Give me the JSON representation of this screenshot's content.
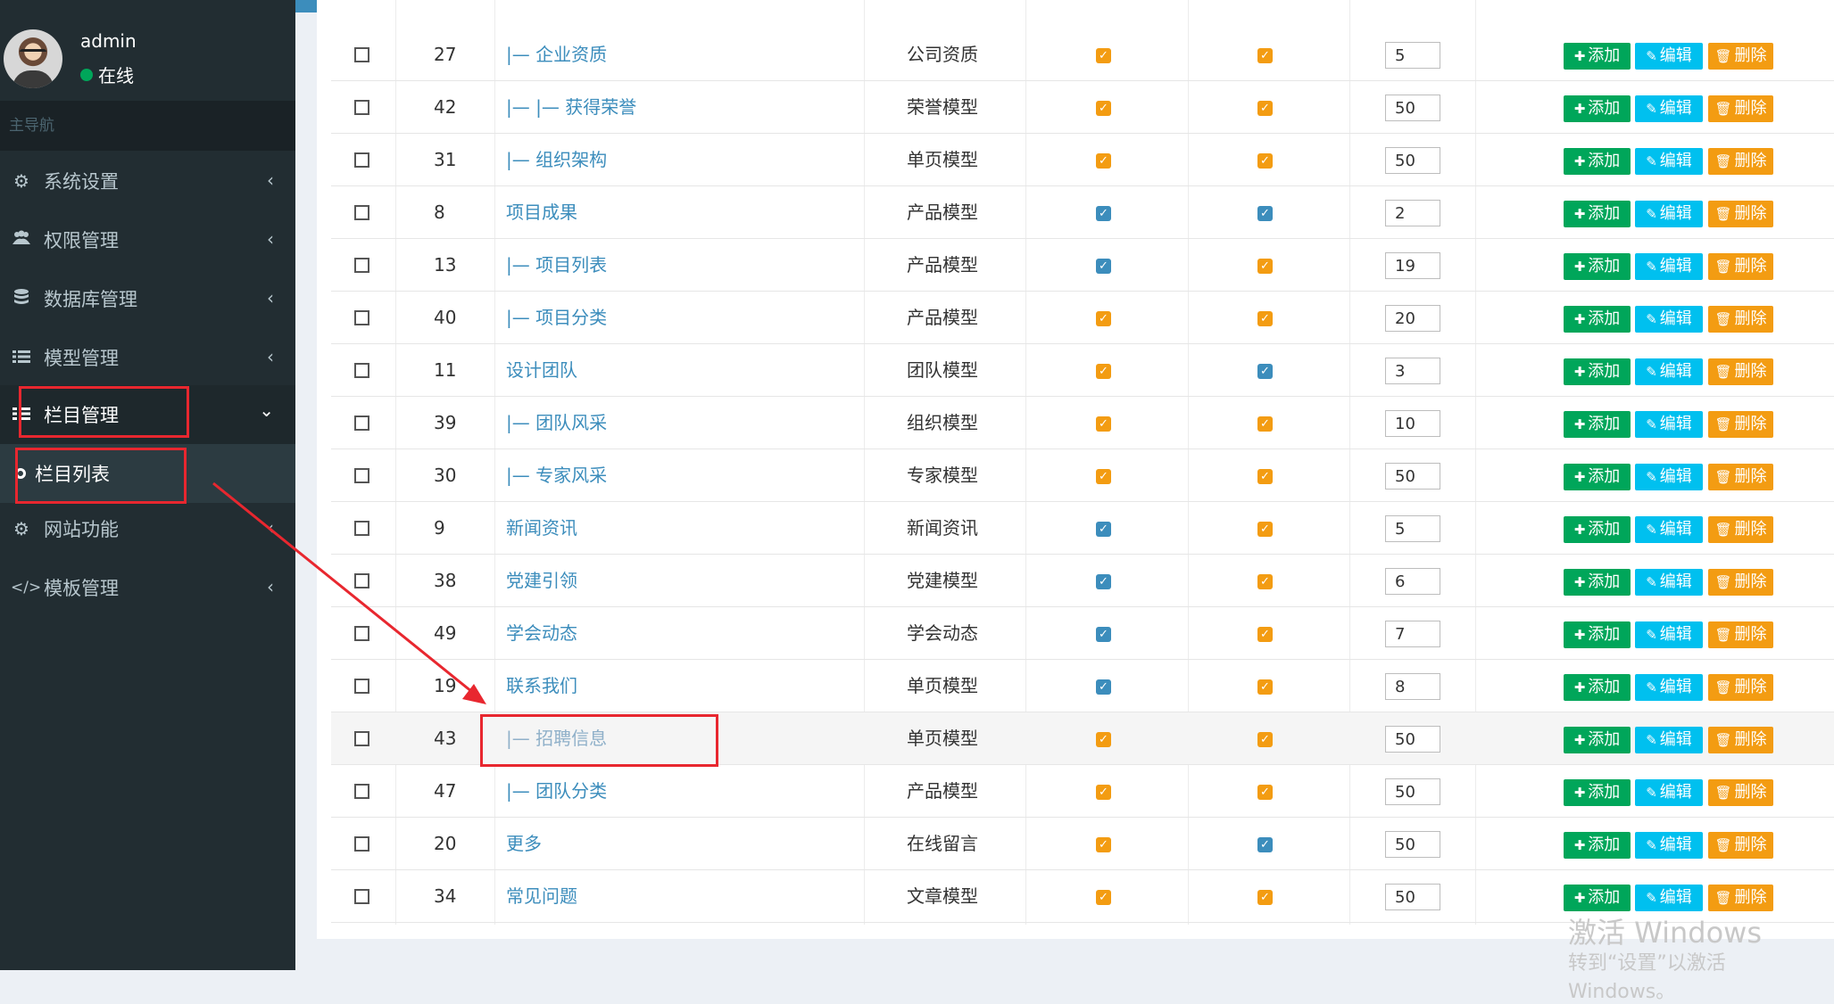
{
  "user": {
    "name": "admin",
    "status": "在线"
  },
  "nav": {
    "header": "主导航",
    "items": [
      {
        "label": "系统设置",
        "icon": "cogs-icon"
      },
      {
        "label": "权限管理",
        "icon": "users-icon"
      },
      {
        "label": "数据库管理",
        "icon": "database-icon"
      },
      {
        "label": "模型管理",
        "icon": "list-icon"
      },
      {
        "label": "栏目管理",
        "icon": "th-list-icon"
      },
      {
        "label": "网站功能",
        "icon": "gear-icon"
      },
      {
        "label": "模板管理",
        "icon": "code-icon"
      }
    ],
    "sub_item": "栏目列表"
  },
  "actions": {
    "add": "添加",
    "edit": "编辑",
    "delete": "删除"
  },
  "rows": [
    {
      "id": "27",
      "name": "|— 企业资质",
      "model": "公司资质",
      "f1": "orange",
      "f2": "orange",
      "sort": "5"
    },
    {
      "id": "42",
      "name": "|— |— 获得荣誉",
      "model": "荣誉模型",
      "f1": "orange",
      "f2": "orange",
      "sort": "50"
    },
    {
      "id": "31",
      "name": "|— 组织架构",
      "model": "单页模型",
      "f1": "orange",
      "f2": "orange",
      "sort": "50"
    },
    {
      "id": "8",
      "name": "项目成果",
      "model": "产品模型",
      "f1": "blue",
      "f2": "blue",
      "sort": "2"
    },
    {
      "id": "13",
      "name": "|— 项目列表",
      "model": "产品模型",
      "f1": "blue",
      "f2": "orange",
      "sort": "19"
    },
    {
      "id": "40",
      "name": "|— 项目分类",
      "model": "产品模型",
      "f1": "orange",
      "f2": "orange",
      "sort": "20"
    },
    {
      "id": "11",
      "name": "设计团队",
      "model": "团队模型",
      "f1": "orange",
      "f2": "blue",
      "sort": "3"
    },
    {
      "id": "39",
      "name": "|— 团队风采",
      "model": "组织模型",
      "f1": "orange",
      "f2": "orange",
      "sort": "10"
    },
    {
      "id": "30",
      "name": "|— 专家风采",
      "model": "专家模型",
      "f1": "orange",
      "f2": "orange",
      "sort": "50"
    },
    {
      "id": "9",
      "name": "新闻资讯",
      "model": "新闻资讯",
      "f1": "blue",
      "f2": "orange",
      "sort": "5"
    },
    {
      "id": "38",
      "name": "党建引领",
      "model": "党建模型",
      "f1": "blue",
      "f2": "orange",
      "sort": "6"
    },
    {
      "id": "49",
      "name": "学会动态",
      "model": "学会动态",
      "f1": "blue",
      "f2": "orange",
      "sort": "7"
    },
    {
      "id": "19",
      "name": "联系我们",
      "model": "单页模型",
      "f1": "blue",
      "f2": "orange",
      "sort": "8"
    },
    {
      "id": "43",
      "name": "|— 招聘信息",
      "model": "单页模型",
      "f1": "orange",
      "f2": "orange",
      "sort": "50"
    },
    {
      "id": "47",
      "name": "|— 团队分类",
      "model": "产品模型",
      "f1": "orange",
      "f2": "orange",
      "sort": "50"
    },
    {
      "id": "20",
      "name": "更多",
      "model": "在线留言",
      "f1": "orange",
      "f2": "blue",
      "sort": "50"
    },
    {
      "id": "34",
      "name": "常见问题",
      "model": "文章模型",
      "f1": "orange",
      "f2": "orange",
      "sort": "50"
    }
  ],
  "highlight_row": "43",
  "watermark": {
    "line1": "激活 Windows",
    "line2": "转到“设置”以激活 Windows。"
  },
  "colors": {
    "sidebar": "#222d32",
    "link": "#3c8dbc",
    "add": "#00a65a",
    "edit": "#00c0ef",
    "delete": "#f39c12",
    "annotation": "#e8272f"
  }
}
